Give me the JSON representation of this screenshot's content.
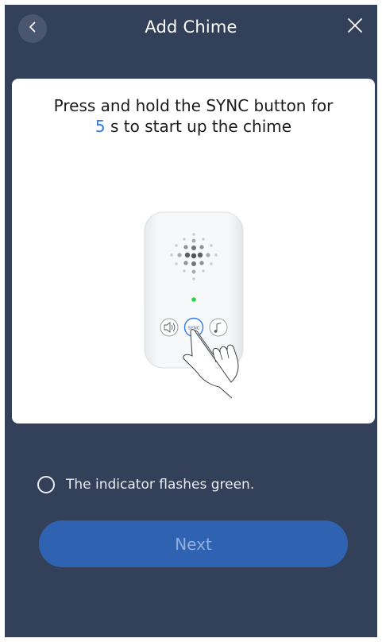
{
  "header": {
    "title": "Add Chime",
    "back_icon": "chevron-left-icon",
    "close_icon": "close-icon"
  },
  "card": {
    "instruction_before": "Press and hold the SYNC button for",
    "instruction_seconds": "5",
    "instruction_after": " s to start up the chime",
    "accent_color": "#2f7be5",
    "device_button_labels": {
      "volume": "volume-icon",
      "sync": "SYNC",
      "music": "music-note-icon"
    },
    "led_color": "#2bd445"
  },
  "indicator": {
    "label": "The indicator flashes green.",
    "checked": false
  },
  "next_button": {
    "label": "Next",
    "enabled": false
  },
  "colors": {
    "background": "#334059",
    "button": "#2f63b2"
  }
}
